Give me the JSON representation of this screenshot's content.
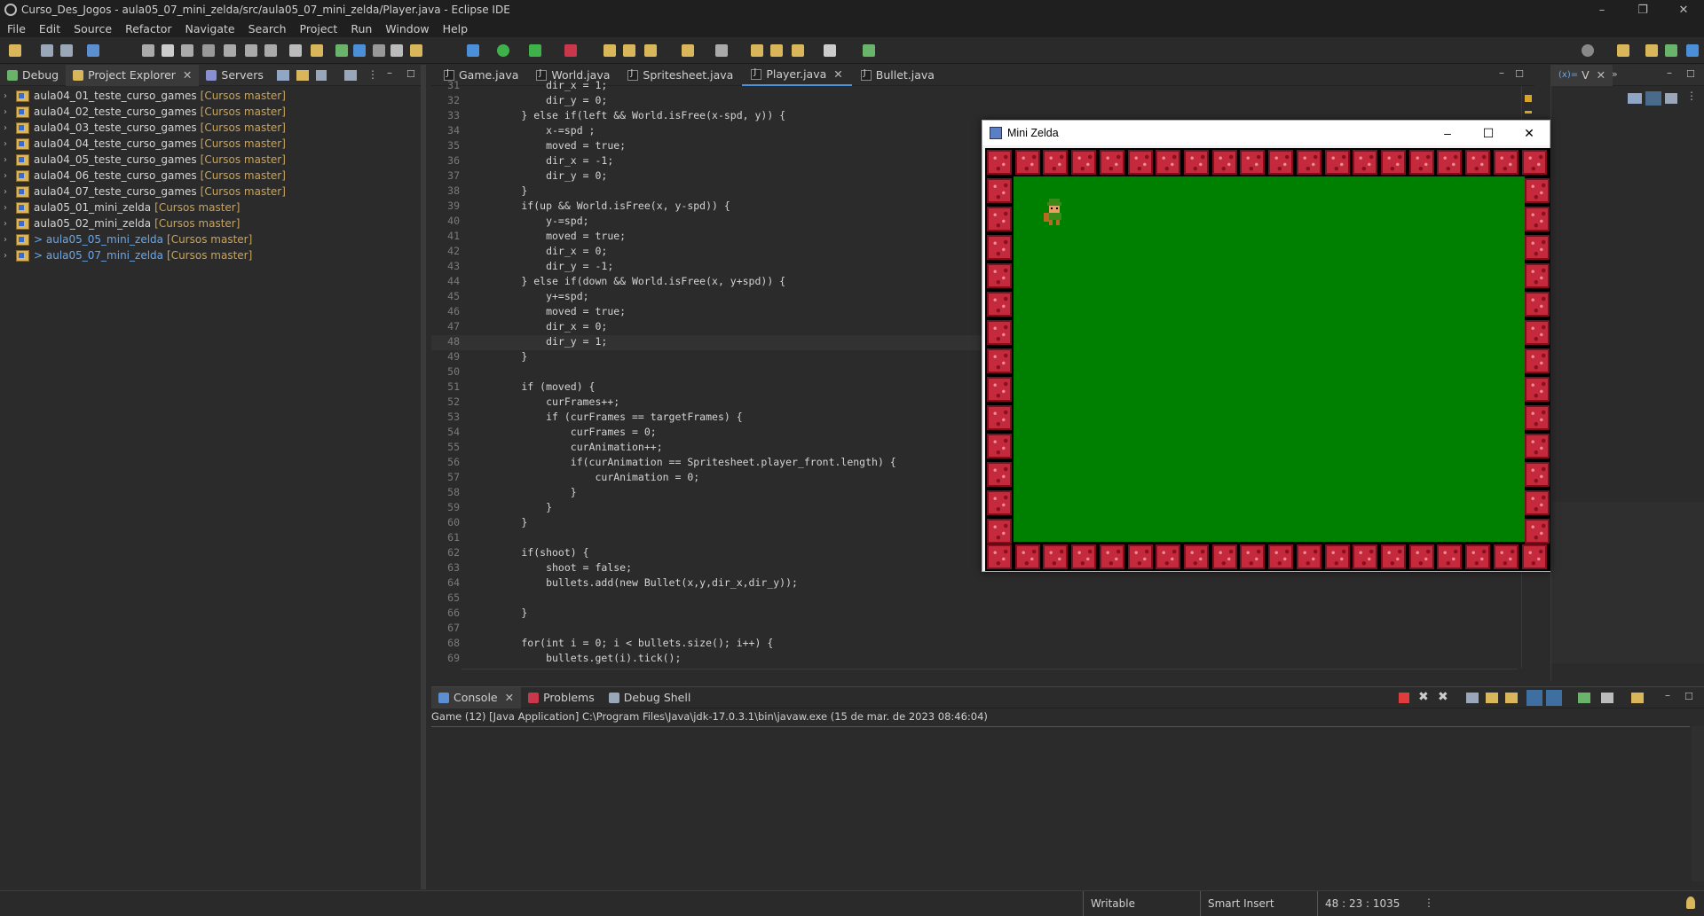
{
  "window": {
    "title": "Curso_Des_Jogos - aula05_07_mini_zelda/src/aula05_07_mini_zelda/Player.java - Eclipse IDE",
    "controls": [
      "–",
      "❐",
      "✕"
    ]
  },
  "menu": [
    "File",
    "Edit",
    "Source",
    "Refactor",
    "Navigate",
    "Search",
    "Project",
    "Run",
    "Window",
    "Help"
  ],
  "left_panel": {
    "tabs": [
      {
        "label": "Debug",
        "icon": "debug-icon"
      },
      {
        "label": "Project Explorer",
        "icon": "project-explorer-icon",
        "active": true
      },
      {
        "label": "Servers",
        "icon": "servers-icon"
      }
    ],
    "projects": [
      {
        "name": "aula04_01_teste_curso_games",
        "repo": "[Cursos master]",
        "changed": false
      },
      {
        "name": "aula04_02_teste_curso_games",
        "repo": "[Cursos master]",
        "changed": false
      },
      {
        "name": "aula04_03_teste_curso_games",
        "repo": "[Cursos master]",
        "changed": false
      },
      {
        "name": "aula04_04_teste_curso_games",
        "repo": "[Cursos master]",
        "changed": false
      },
      {
        "name": "aula04_05_teste_curso_games",
        "repo": "[Cursos master]",
        "changed": false
      },
      {
        "name": "aula04_06_teste_curso_games",
        "repo": "[Cursos master]",
        "changed": false
      },
      {
        "name": "aula04_07_teste_curso_games",
        "repo": "[Cursos master]",
        "changed": false
      },
      {
        "name": "aula05_01_mini_zelda",
        "repo": "[Cursos master]",
        "changed": false
      },
      {
        "name": "aula05_02_mini_zelda",
        "repo": "[Cursos master]",
        "changed": false
      },
      {
        "name": "> aula05_05_mini_zelda",
        "repo": "[Cursos master]",
        "changed": true
      },
      {
        "name": "> aula05_07_mini_zelda",
        "repo": "[Cursos master]",
        "changed": true
      }
    ]
  },
  "editor": {
    "tabs": [
      {
        "label": "Game.java"
      },
      {
        "label": "World.java"
      },
      {
        "label": "Spritesheet.java"
      },
      {
        "label": "Player.java",
        "active": true
      },
      {
        "label": "Bullet.java"
      }
    ],
    "lines": [
      {
        "n": "31",
        "t": "            dir_x = 1;"
      },
      {
        "n": "32",
        "t": "            dir_y = 0;"
      },
      {
        "n": "33",
        "t": "        } else if(left && World.isFree(x-spd, y)) {"
      },
      {
        "n": "34",
        "t": "            x-=spd ;"
      },
      {
        "n": "35",
        "t": "            moved = true;"
      },
      {
        "n": "36",
        "t": "            dir_x = -1;"
      },
      {
        "n": "37",
        "t": "            dir_y = 0;"
      },
      {
        "n": "38",
        "t": "        }"
      },
      {
        "n": "39",
        "t": "        if(up && World.isFree(x, y-spd)) {"
      },
      {
        "n": "40",
        "t": "            y-=spd;"
      },
      {
        "n": "41",
        "t": "            moved = true;"
      },
      {
        "n": "42",
        "t": "            dir_x = 0;"
      },
      {
        "n": "43",
        "t": "            dir_y = -1;"
      },
      {
        "n": "44",
        "t": "        } else if(down && World.isFree(x, y+spd)) {"
      },
      {
        "n": "45",
        "t": "            y+=spd;"
      },
      {
        "n": "46",
        "t": "            moved = true;"
      },
      {
        "n": "47",
        "t": "            dir_x = 0;"
      },
      {
        "n": "48",
        "t": "            dir_y = 1;",
        "current": true
      },
      {
        "n": "49",
        "t": "        }"
      },
      {
        "n": "50",
        "t": ""
      },
      {
        "n": "51",
        "t": "        if (moved) {"
      },
      {
        "n": "52",
        "t": "            curFrames++;"
      },
      {
        "n": "53",
        "t": "            if (curFrames == targetFrames) {"
      },
      {
        "n": "54",
        "t": "                curFrames = 0;"
      },
      {
        "n": "55",
        "t": "                curAnimation++;"
      },
      {
        "n": "56",
        "t": "                if(curAnimation == Spritesheet.player_front.length) {"
      },
      {
        "n": "57",
        "t": "                    curAnimation = 0;"
      },
      {
        "n": "58",
        "t": "                }"
      },
      {
        "n": "59",
        "t": "            }"
      },
      {
        "n": "60",
        "t": "        }"
      },
      {
        "n": "61",
        "t": ""
      },
      {
        "n": "62",
        "t": "        if(shoot) {"
      },
      {
        "n": "63",
        "t": "            shoot = false;"
      },
      {
        "n": "64",
        "t": "            bullets.add(new Bullet(x,y,dir_x,dir_y));"
      },
      {
        "n": "65",
        "t": ""
      },
      {
        "n": "66",
        "t": "        }"
      },
      {
        "n": "67",
        "t": ""
      },
      {
        "n": "68",
        "t": "        for(int i = 0; i < bullets.size(); i++) {"
      },
      {
        "n": "69",
        "t": "            bullets.get(i).tick();"
      }
    ]
  },
  "right_panel": {
    "tab_label": "V"
  },
  "console": {
    "tabs": [
      {
        "label": "Console",
        "icon": "console-icon",
        "active": true
      },
      {
        "label": "Problems",
        "icon": "problems-icon"
      },
      {
        "label": "Debug Shell",
        "icon": "debug-shell-icon"
      }
    ],
    "process": "Game (12) [Java Application] C:\\Program Files\\Java\\jdk-17.0.3.1\\bin\\javaw.exe  (15 de mar. de 2023 08:46:04)"
  },
  "status": {
    "writable": "Writable",
    "insert_mode": "Smart Insert",
    "position": "48 : 23 : 1035"
  },
  "game_window": {
    "title": "Mini Zelda",
    "grass_color": "#008000",
    "brick_color": "#c42a3c"
  }
}
